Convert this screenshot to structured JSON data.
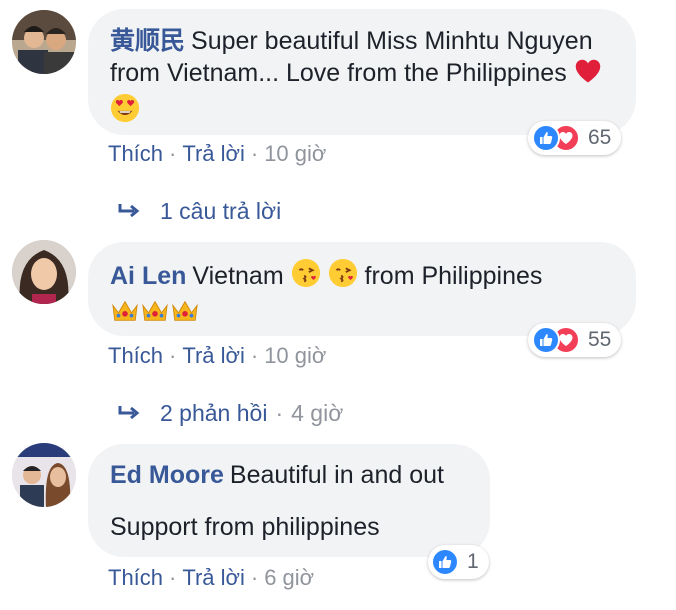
{
  "comments": [
    {
      "author": "黄顺民",
      "text": "Super beautiful Miss Minhtu Nguyen from Vietnam... Love from the Philippines",
      "emojis": [
        "heart-emoji",
        "heart-eyes-emoji"
      ],
      "reaction_count": "65",
      "reactions": [
        "like",
        "love"
      ],
      "like_label": "Thích",
      "reply_label": "Trả lời",
      "time": "10 giờ",
      "replies_text": "1 câu trả lời",
      "replies_time": ""
    },
    {
      "author": "Ai Len",
      "text_before": "Vietnam",
      "text_after": "from Philippines",
      "emojis": [
        "kiss-emoji",
        "kiss-emoji",
        "crown-emoji",
        "crown-emoji",
        "crown-emoji"
      ],
      "reaction_count": "55",
      "reactions": [
        "like",
        "love"
      ],
      "like_label": "Thích",
      "reply_label": "Trả lời",
      "time": "10 giờ",
      "replies_text": "2 phản hồi",
      "replies_time": "4 giờ"
    },
    {
      "author": "Ed Moore",
      "text_line1": "Beautiful in and out",
      "text_line2": "Support from philippines",
      "reaction_count": "1",
      "reactions": [
        "like"
      ],
      "like_label": "Thích",
      "reply_label": "Trả lời",
      "time": "6 giờ"
    }
  ],
  "colors": {
    "author": "#385898",
    "bubble": "#f2f3f5",
    "like": "#2d88ff",
    "love": "#f33e58",
    "meta": "#90949c"
  }
}
